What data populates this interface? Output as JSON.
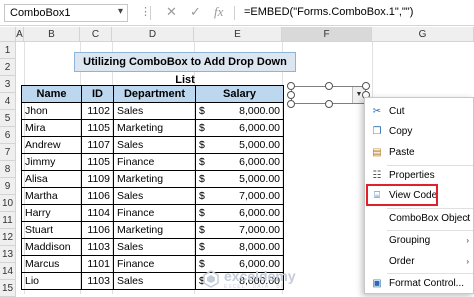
{
  "formula_bar": {
    "name_box": "ComboBox1",
    "formula": "=EMBED(\"Forms.ComboBox.1\",\"\")",
    "cancel_icon": "x-icon",
    "enter_icon": "check-icon",
    "function_icon": "fx-icon"
  },
  "columns": [
    "A",
    "B",
    "C",
    "D",
    "E",
    "F",
    "G"
  ],
  "rows": [
    "1",
    "2",
    "3",
    "4",
    "5",
    "6",
    "7",
    "8",
    "9",
    "10",
    "11",
    "12",
    "13",
    "14",
    "15"
  ],
  "sheet_title": "Utilizing ComboBox to Add Drop Down List",
  "table": {
    "headers": [
      "Name",
      "ID",
      "Department",
      "Salary"
    ],
    "currency": "$",
    "rows": [
      [
        "Jhon",
        "1102",
        "Sales",
        "8,000.00"
      ],
      [
        "Mira",
        "1105",
        "Marketing",
        "6,000.00"
      ],
      [
        "Andrew",
        "1107",
        "Sales",
        "5,000.00"
      ],
      [
        "Jimmy",
        "1105",
        "Finance",
        "6,000.00"
      ],
      [
        "Alisa",
        "1109",
        "Marketing",
        "5,000.00"
      ],
      [
        "Martha",
        "1106",
        "Sales",
        "7,000.00"
      ],
      [
        "Harry",
        "1104",
        "Finance",
        "6,000.00"
      ],
      [
        "Stuart",
        "1106",
        "Marketing",
        "7,000.00"
      ],
      [
        "Maddison",
        "1103",
        "Sales",
        "8,000.00"
      ],
      [
        "Marcus",
        "1101",
        "Finance",
        "6,000.00"
      ],
      [
        "Lio",
        "1103",
        "Sales",
        "8,000.00"
      ]
    ]
  },
  "context_menu": {
    "items": [
      {
        "label": "Cut",
        "icon": "scissors-icon"
      },
      {
        "label": "Copy",
        "icon": "copy-icon"
      },
      {
        "label": "Paste",
        "icon": "paste-icon"
      },
      {
        "label": "Properties",
        "icon": "properties-icon"
      },
      {
        "label": "View Code",
        "icon": "view-code-icon"
      },
      {
        "label": "ComboBox Object",
        "icon": ""
      },
      {
        "label": "Grouping",
        "icon": ""
      },
      {
        "label": "Order",
        "icon": ""
      },
      {
        "label": "Format Control...",
        "icon": "format-control-icon"
      }
    ],
    "highlight_color": "#e0212c"
  },
  "watermark": {
    "name": "exceldemy",
    "tagline": "EXCEL · DATA · BI"
  }
}
